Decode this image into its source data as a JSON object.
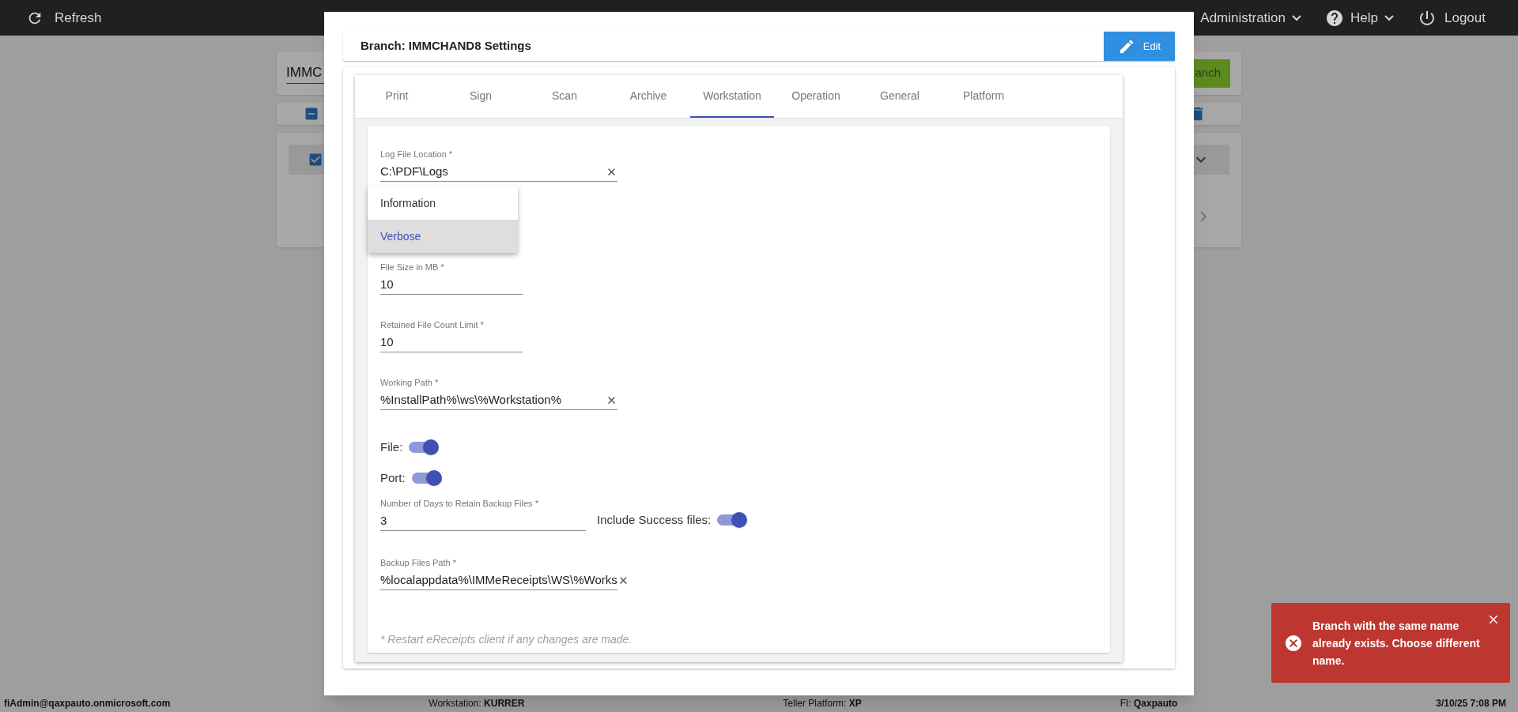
{
  "top_bar": {
    "refresh": "Refresh",
    "menus": [
      {
        "label": "Administration"
      },
      {
        "label": "Help",
        "kind": "help"
      }
    ],
    "logout": "Logout"
  },
  "background": {
    "search_value": "IMMC",
    "button": "anch"
  },
  "dialog": {
    "title": "Branch: IMMCHAND8 Settings",
    "edit_button": "Edit",
    "tabs": [
      {
        "label": "Print",
        "selected": false
      },
      {
        "label": "Sign",
        "selected": false
      },
      {
        "label": "Scan",
        "selected": false
      },
      {
        "label": "Archive",
        "selected": false
      },
      {
        "label": "Workstation",
        "selected": true
      },
      {
        "label": "Operation",
        "selected": false
      },
      {
        "label": "General",
        "selected": false
      },
      {
        "label": "Platform",
        "selected": false
      }
    ],
    "dropdown_menu": [
      {
        "label": "Information",
        "selected": false
      },
      {
        "label": "Verbose",
        "selected": true
      }
    ],
    "rows": [
      {
        "items": [
          {
            "kind": "path",
            "label": "Log File Location *",
            "value": "C:\\PDF\\Logs"
          }
        ]
      },
      {
        "items": [
          {
            "kind": "number",
            "label": "File Size in MB *",
            "value": "10"
          }
        ]
      },
      {
        "items": [
          {
            "kind": "number",
            "label": "Retained File Count Limit *",
            "value": "10"
          }
        ]
      },
      {
        "items": [
          {
            "kind": "path",
            "label": "Working Path *",
            "value": "%InstallPath%\\ws\\%Workstation%"
          }
        ]
      },
      {
        "items": [
          {
            "kind": "toggle",
            "label": "File:",
            "on": true
          }
        ]
      },
      {
        "items": [
          {
            "kind": "toggle",
            "label": "Port:",
            "on": true
          }
        ]
      },
      {
        "items": [
          {
            "kind": "number",
            "label": "Number of Days to Retain Backup Files *",
            "value": "3"
          },
          {
            "kind": "toggle",
            "label": "Include Success files:",
            "on": true
          }
        ]
      },
      {
        "items": [
          {
            "kind": "path",
            "label": "Backup Files Path *",
            "value": "%localappdata%\\IMMeReceipts\\WS\\%Works"
          }
        ]
      }
    ],
    "note": "* Restart eReceipts client if any changes are made."
  },
  "toast": {
    "message": "Branch with the same name already exists. Choose different name."
  },
  "status_bar": [
    "**fiAdmin@qaxpauto.onmicrosoft.com**",
    "Workstation: **KURRER**",
    "Teller Platform: **XP**",
    "FI: **Qaxpauto**",
    "**3/10/25 7:08 PM**"
  ]
}
